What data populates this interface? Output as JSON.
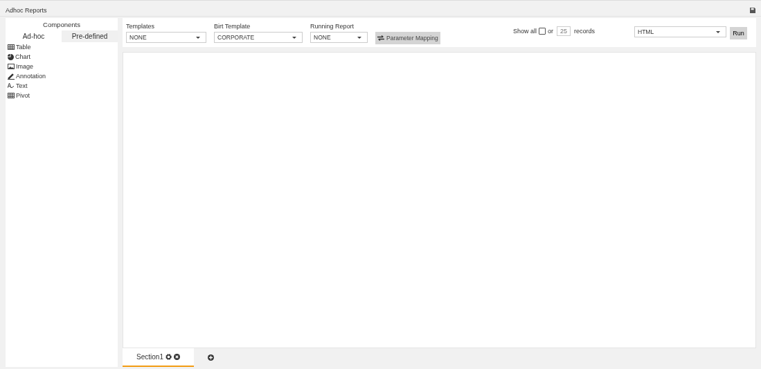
{
  "window": {
    "title": "Adhoc Reports"
  },
  "sidebar": {
    "title": "Components",
    "tabs": [
      {
        "label": "Ad-hoc",
        "selected": true
      },
      {
        "label": "Pre-defined",
        "selected": false
      }
    ],
    "items": [
      {
        "kind": "table",
        "label": "Table"
      },
      {
        "kind": "chart",
        "label": "Chart"
      },
      {
        "kind": "image",
        "label": "Image"
      },
      {
        "kind": "annotation",
        "label": "Annotation"
      },
      {
        "kind": "text",
        "label": "Text"
      },
      {
        "kind": "pivot",
        "label": "Pivot"
      }
    ]
  },
  "toolbar": {
    "selects": [
      {
        "label": "Templates",
        "value": "NONE"
      },
      {
        "label": "Birt Template",
        "value": "CORPORATE"
      },
      {
        "label": "Running Report",
        "value": "NONE"
      }
    ],
    "mapping_button": "Parameter Mapping",
    "show_all_label": "Show all",
    "show_all_checked": false,
    "or_label": "or",
    "records_count": "25",
    "records_label": "records",
    "format": "HTML",
    "run_button": "Run"
  },
  "sections": [
    {
      "label": "Section1",
      "selected": true
    }
  ]
}
